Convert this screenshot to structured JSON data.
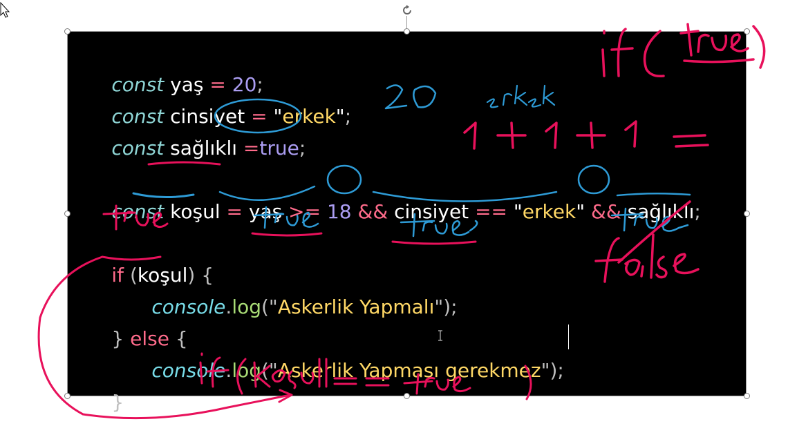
{
  "code": {
    "line1": {
      "kw": "const",
      "name": "yaş",
      "op": "=",
      "value": "20",
      "end": ";"
    },
    "line2": {
      "kw": "const",
      "name": "cinsiyet",
      "op": "=",
      "q1": "\"",
      "str": "erkek",
      "q2": "\"",
      "end": ";"
    },
    "line3": {
      "kw": "const",
      "name": "sağlıklı",
      "op": "=",
      "value": "true",
      "end": ";"
    },
    "line5": {
      "kw": "const",
      "name": "koşul",
      "op": "=",
      "a": "yaş",
      "gte": ">=",
      "num": "18",
      "and1": "&&",
      "b": "cinsiyet",
      "eq": "==",
      "q1": "\"",
      "str": "erkek",
      "q2": "\"",
      "and2": "&&",
      "c": "sağlıklı",
      "end": ";"
    },
    "line7": {
      "kw": "if",
      "open": "(",
      "cond": "koşul",
      "close": ")",
      "brace": "{"
    },
    "line8": {
      "obj": "console",
      "dot": ".",
      "method": "log",
      "open": "(\"",
      "str": "Askerlik Yapmalı",
      "close": "\");"
    },
    "line9": {
      "brace1": "}",
      "kw": "else",
      "brace2": "{"
    },
    "line10": {
      "obj": "console",
      "dot": ".",
      "method": "log",
      "open": "(\"",
      "str": "Askerlik Yapması gerekmez",
      "close": "\");"
    },
    "line11": {
      "brace": "}"
    }
  },
  "annotations": {
    "top_right": "if(true)",
    "value_20": "20",
    "value_erkek": "erkek",
    "sum": "1 + 1 + 1 =",
    "true_above_if": "true",
    "true_under_yas": "true",
    "true_under_cinsiyet": "true",
    "true_under_saglikli": "true",
    "false_label": "false",
    "bottom": "if(koşul==true)"
  },
  "colors": {
    "background": "#000000",
    "ink_pink": "#e8115b",
    "ink_blue": "#2e9bd6",
    "keyword_const": "#8fd6d6",
    "keyword_ctrl": "#ff6b8b",
    "number": "#ab9df2",
    "string": "#ffd866",
    "method": "#a9dc76"
  }
}
